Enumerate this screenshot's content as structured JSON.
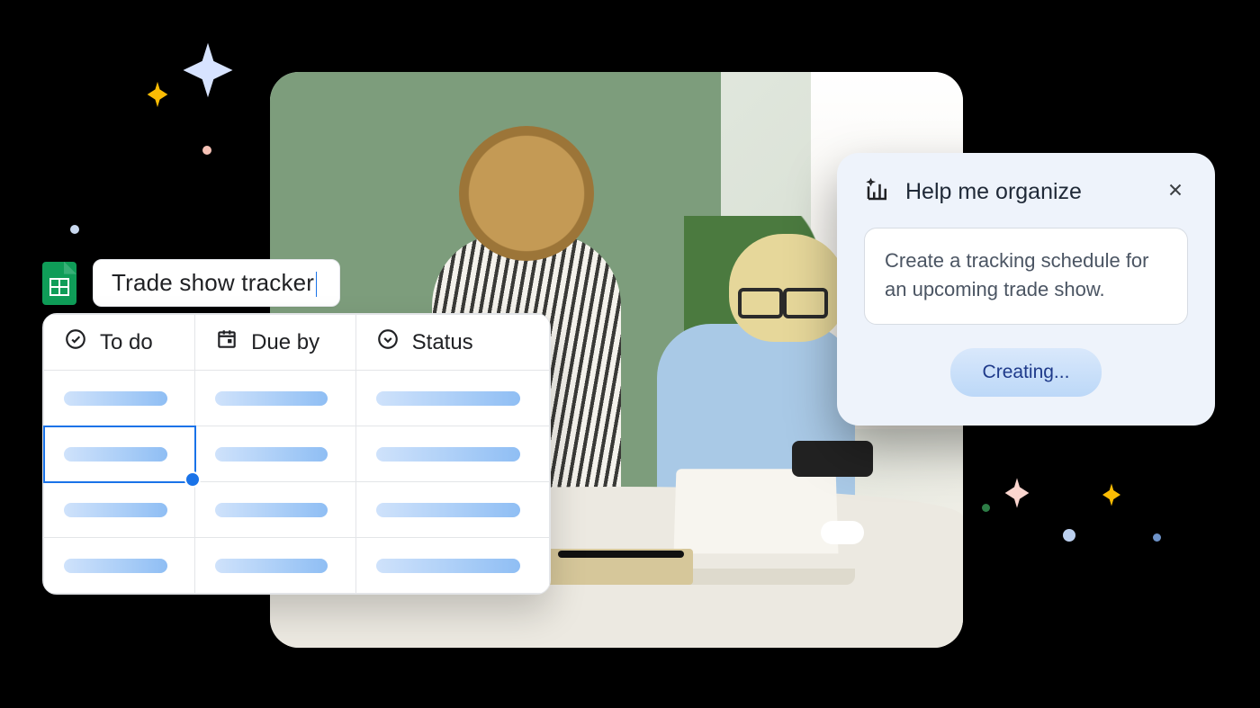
{
  "doc": {
    "title": "Trade show tracker"
  },
  "columns": {
    "todo": {
      "label": "To do"
    },
    "dueby": {
      "label": "Due by"
    },
    "status": {
      "label": "Status"
    }
  },
  "hmo": {
    "title": "Help me organize",
    "prompt": "Create a tracking schedule for an upcoming trade show.",
    "button": "Creating..."
  },
  "icons": {
    "sheets": "google-sheets",
    "todo": "check-circle",
    "dueby": "calendar",
    "status": "dropdown-circle",
    "close": "close",
    "hmo": "sparkle-chart"
  }
}
